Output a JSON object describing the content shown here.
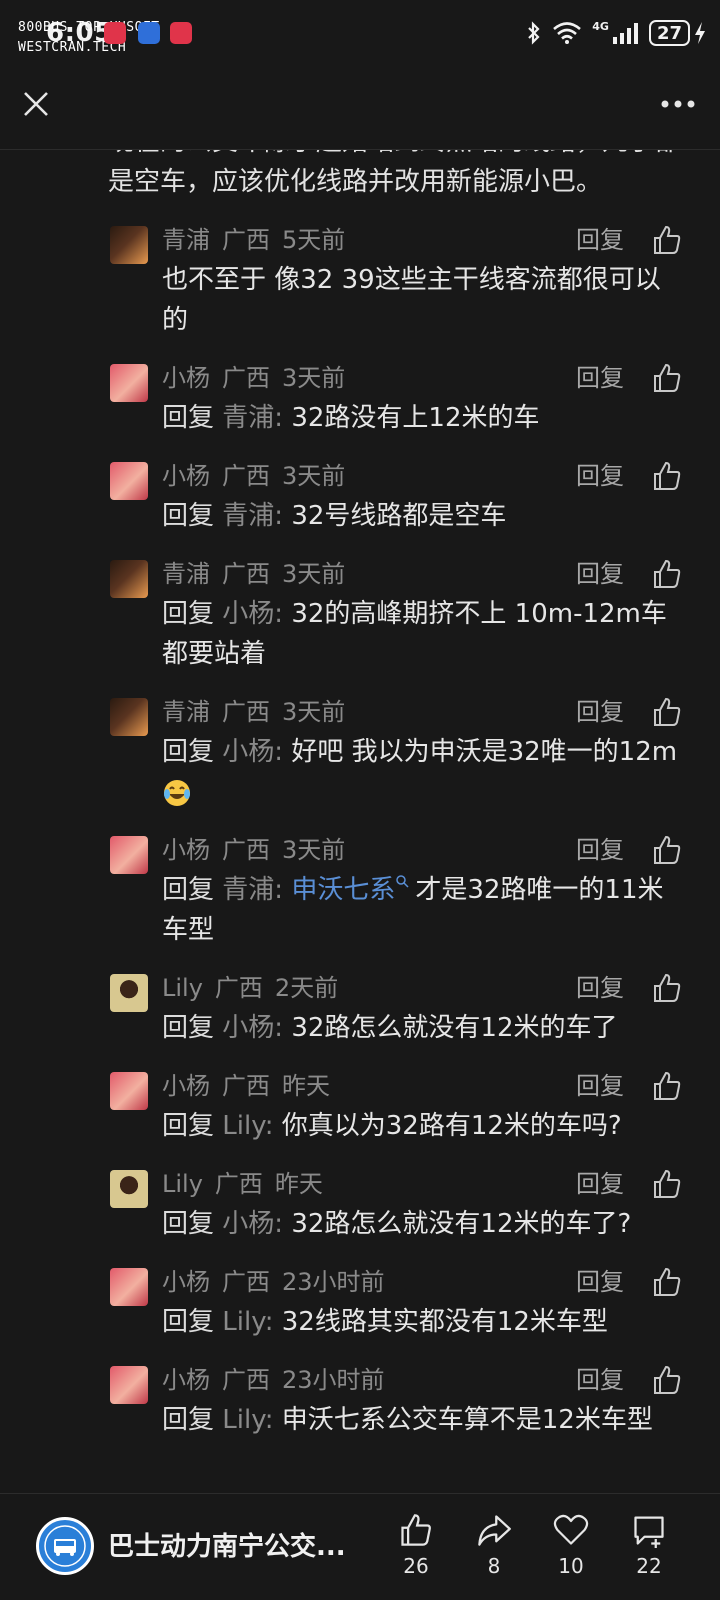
{
  "status_bar": {
    "time": "6:05",
    "watermark_line1": "800BUS TOP XHSOFT",
    "watermark_line2": "WESTCRAN.TECH",
    "network_label": "4G",
    "battery": "27"
  },
  "post_text_tail": {
    "line1": "现在的公交车除了起始站到终点站的线路，几乎都",
    "line2": "是空车，应该优化线路并改用新能源小巴。"
  },
  "comments": [
    {
      "user": "青浦",
      "region": "广西",
      "time": "5天前",
      "reply_to": "",
      "text": "也不至于 像32 39这些主干线客流都很可以的",
      "avatar": "qingpu"
    },
    {
      "user": "小杨",
      "region": "广西",
      "time": "3天前",
      "reply_to": "青浦:",
      "text": "32路没有上12米的车",
      "avatar": "xiaoyang"
    },
    {
      "user": "小杨",
      "region": "广西",
      "time": "3天前",
      "reply_to": "青浦:",
      "text": "32号线路都是空车",
      "avatar": "xiaoyang"
    },
    {
      "user": "青浦",
      "region": "广西",
      "time": "3天前",
      "reply_to": "小杨:",
      "text": "32的高峰期挤不上 10m-12m车都要站着",
      "avatar": "qingpu"
    },
    {
      "user": "青浦",
      "region": "广西",
      "time": "3天前",
      "reply_to": "小杨:",
      "text": "好吧 我以为申沃是32唯一的12m",
      "avatar": "qingpu",
      "emoji": "laughing-tears-emoji"
    },
    {
      "user": "小杨",
      "region": "广西",
      "time": "3天前",
      "reply_to": "青浦:",
      "link": "申沃七系",
      "text": "才是32路唯一的11米车型",
      "avatar": "xiaoyang"
    },
    {
      "user": "Lily",
      "region": "广西",
      "time": "2天前",
      "reply_to": "小杨:",
      "text": "32路怎么就没有12米的车了",
      "avatar": "lily"
    },
    {
      "user": "小杨",
      "region": "广西",
      "time": "昨天",
      "reply_to": "Lily:",
      "text": "你真以为32路有12米的车吗?",
      "avatar": "xiaoyang"
    },
    {
      "user": "Lily",
      "region": "广西",
      "time": "昨天",
      "reply_to": "小杨:",
      "text": "32路怎么就没有12米的车了?",
      "avatar": "lily"
    },
    {
      "user": "小杨",
      "region": "广西",
      "time": "23小时前",
      "reply_to": "Lily:",
      "text": "32线路其实都没有12米车型",
      "avatar": "xiaoyang"
    },
    {
      "user": "小杨",
      "region": "广西",
      "time": "23小时前",
      "reply_to": "Lily:",
      "text": "申沃七系公交车算不是12米车型",
      "avatar": "xiaoyang"
    }
  ],
  "labels": {
    "reply_button": "回复",
    "reply_prefix": "回复"
  },
  "bottom_bar": {
    "channel_name": "巴士动力南宁公交...",
    "likes": "26",
    "shares": "8",
    "favorites": "10",
    "comments": "22"
  },
  "colors": {
    "background": "#181818",
    "text": "#e6e6e6",
    "muted": "#8a8a8a",
    "link": "#5a8fd6"
  }
}
